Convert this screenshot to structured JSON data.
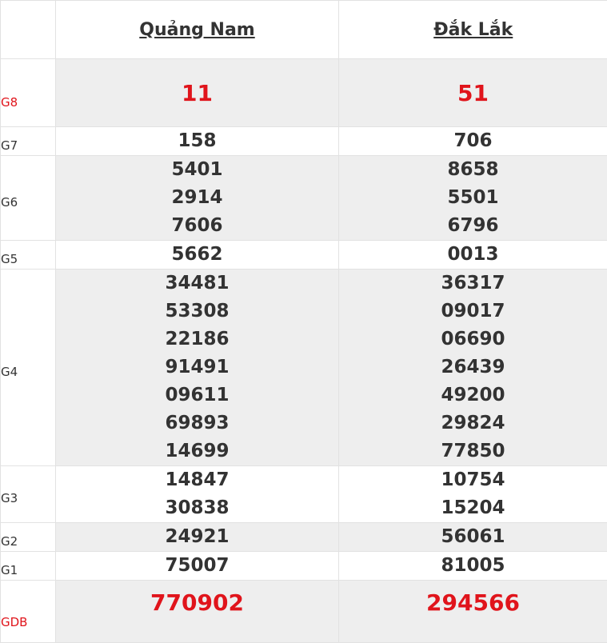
{
  "provinces": [
    "Quảng Nam",
    "Đắk Lắk"
  ],
  "prizes": [
    {
      "label": "G8",
      "quang_nam": [
        "11"
      ],
      "dak_lak": [
        "51"
      ]
    },
    {
      "label": "G7",
      "quang_nam": [
        "158"
      ],
      "dak_lak": [
        "706"
      ]
    },
    {
      "label": "G6",
      "quang_nam": [
        "5401",
        "2914",
        "7606"
      ],
      "dak_lak": [
        "8658",
        "5501",
        "6796"
      ]
    },
    {
      "label": "G5",
      "quang_nam": [
        "5662"
      ],
      "dak_lak": [
        "0013"
      ]
    },
    {
      "label": "G4",
      "quang_nam": [
        "34481",
        "53308",
        "22186",
        "91491",
        "09611",
        "69893",
        "14699"
      ],
      "dak_lak": [
        "36317",
        "09017",
        "06690",
        "26439",
        "49200",
        "29824",
        "77850"
      ]
    },
    {
      "label": "G3",
      "quang_nam": [
        "14847",
        "30838"
      ],
      "dak_lak": [
        "10754",
        "15204"
      ]
    },
    {
      "label": "G2",
      "quang_nam": [
        "24921"
      ],
      "dak_lak": [
        "56061"
      ]
    },
    {
      "label": "G1",
      "quang_nam": [
        "75007"
      ],
      "dak_lak": [
        "81005"
      ]
    },
    {
      "label": "GDB",
      "quang_nam": [
        "770902"
      ],
      "dak_lak": [
        "294566"
      ]
    }
  ],
  "colors": {
    "highlight": "#e0141b",
    "text": "#333333",
    "shade": "#eeeeee",
    "border": "#e2e2e2"
  }
}
